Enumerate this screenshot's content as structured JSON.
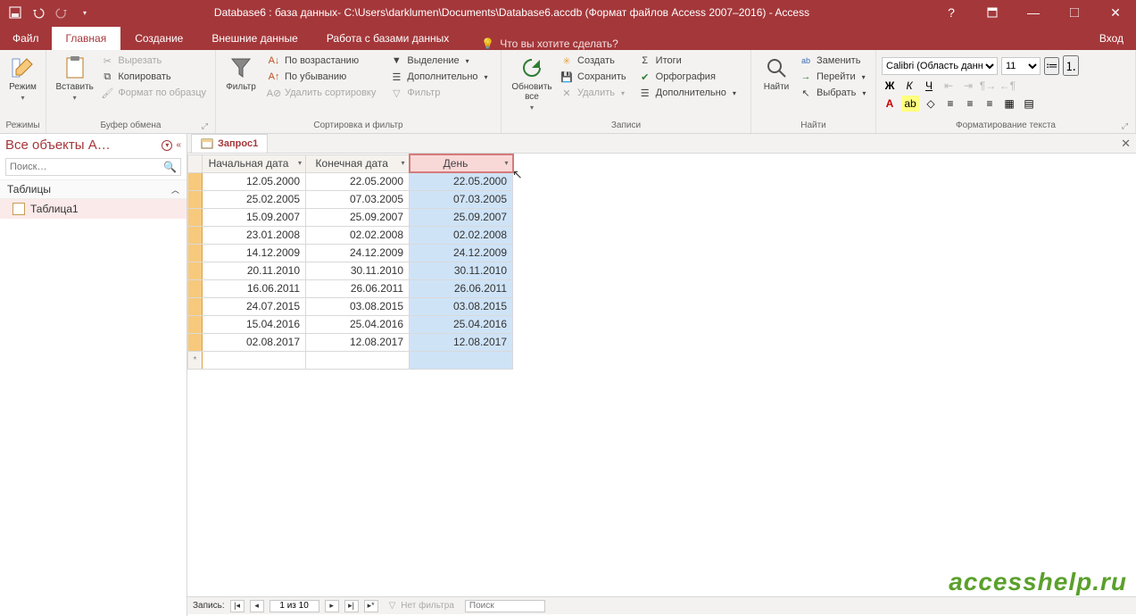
{
  "title": "Database6 : база данных- C:\\Users\\darklumen\\Documents\\Database6.accdb (Формат файлов Access 2007–2016) - Access",
  "win": {
    "help": "?",
    "signin": "Вход"
  },
  "tabs": {
    "file": "Файл",
    "list": [
      "Главная",
      "Создание",
      "Внешние данные",
      "Работа с базами данных"
    ],
    "active": 0,
    "tell_me": "Что вы хотите сделать?"
  },
  "ribbon": {
    "views": {
      "btn": "Режим",
      "label": "Режимы"
    },
    "clipboard": {
      "paste": "Вставить",
      "cut": "Вырезать",
      "copy": "Копировать",
      "format": "Формат по образцу",
      "label": "Буфер обмена"
    },
    "sort": {
      "filter": "Фильтр",
      "asc": "По возрастанию",
      "desc": "По убыванию",
      "clear": "Удалить сортировку",
      "selection": "Выделение",
      "advanced": "Дополнительно",
      "toggle": "Фильтр",
      "label": "Сортировка и фильтр"
    },
    "records": {
      "refresh": "Обновить все",
      "new": "Создать",
      "save": "Сохранить",
      "delete": "Удалить",
      "totals": "Итоги",
      "spell": "Орфография",
      "more": "Дополнительно",
      "label": "Записи"
    },
    "find": {
      "find": "Найти",
      "replace": "Заменить",
      "goto": "Перейти",
      "select": "Выбрать",
      "label": "Найти"
    },
    "format": {
      "font_name": "Calibri (Область данных)",
      "font_size": "11",
      "label": "Форматирование текста"
    }
  },
  "nav": {
    "header": "Все объекты A…",
    "search_ph": "Поиск…",
    "cat": "Таблицы",
    "items": [
      "Таблица1"
    ]
  },
  "doc": {
    "tab": "Запрос1"
  },
  "grid": {
    "headers": [
      "Начальная дата",
      "Конечная дата",
      "День"
    ],
    "rows": [
      [
        "12.05.2000",
        "22.05.2000",
        "22.05.2000"
      ],
      [
        "25.02.2005",
        "07.03.2005",
        "07.03.2005"
      ],
      [
        "15.09.2007",
        "25.09.2007",
        "25.09.2007"
      ],
      [
        "23.01.2008",
        "02.02.2008",
        "02.02.2008"
      ],
      [
        "14.12.2009",
        "24.12.2009",
        "24.12.2009"
      ],
      [
        "20.11.2010",
        "30.11.2010",
        "30.11.2010"
      ],
      [
        "16.06.2011",
        "26.06.2011",
        "26.06.2011"
      ],
      [
        "24.07.2015",
        "03.08.2015",
        "03.08.2015"
      ],
      [
        "15.04.2016",
        "25.04.2016",
        "25.04.2016"
      ],
      [
        "02.08.2017",
        "12.08.2017",
        "12.08.2017"
      ]
    ],
    "selected_col": 2
  },
  "status": {
    "label": "Запись:",
    "pos": "1 из 10",
    "filter": "Нет фильтра",
    "search_ph": "Поиск"
  },
  "watermark": "accesshelp.ru"
}
